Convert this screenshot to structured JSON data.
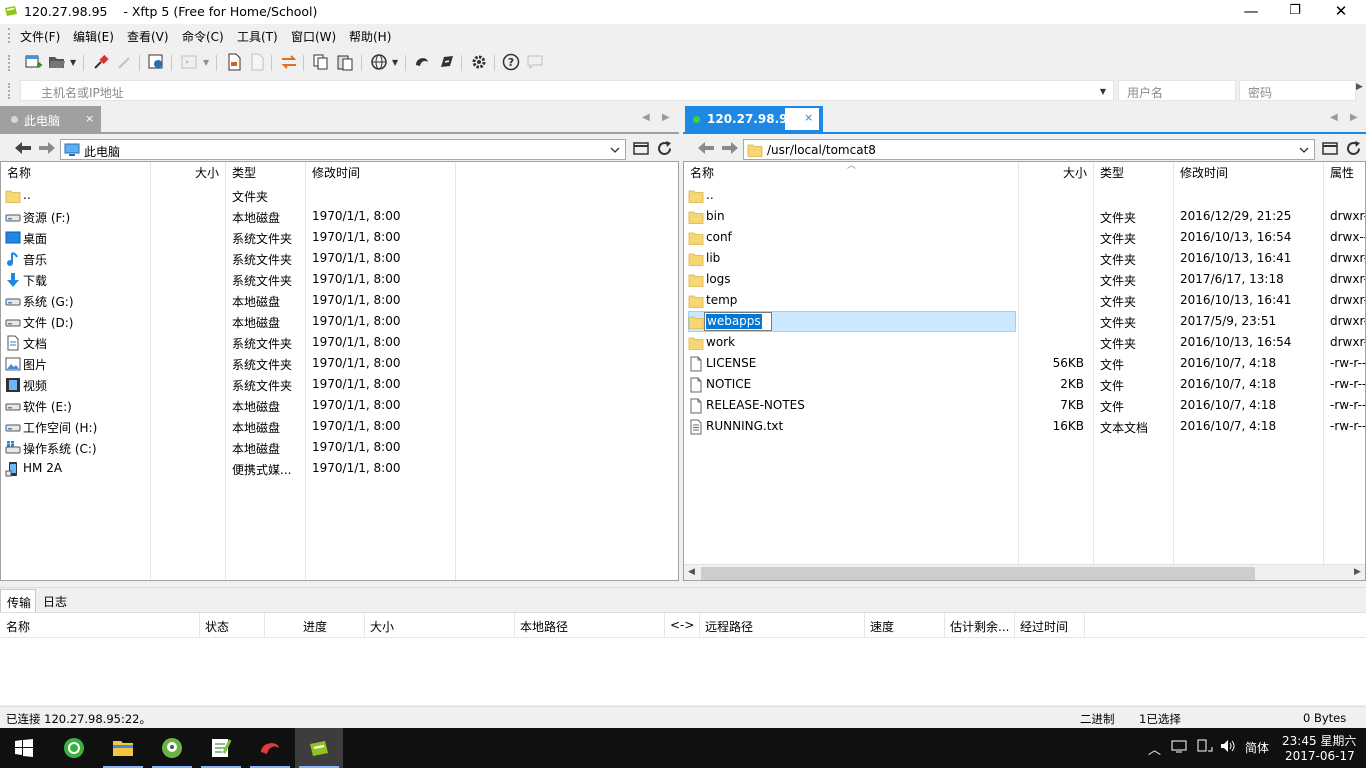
{
  "window": {
    "title": "120.27.98.95    - Xftp 5 (Free for Home/School)",
    "minimize": "—",
    "restore": "❐",
    "close": "✕"
  },
  "menu": [
    "文件(F)",
    "编辑(E)",
    "查看(V)",
    "命令(C)",
    "工具(T)",
    "窗口(W)",
    "帮助(H)"
  ],
  "address": {
    "host_placeholder": "主机名或IP地址",
    "user_placeholder": "用户名",
    "password_placeholder": "密码"
  },
  "local_pane": {
    "tab_label": "此电脑",
    "tab_close": "×",
    "path": "此电脑",
    "columns": [
      "名称",
      "大小",
      "类型",
      "修改时间"
    ],
    "rows": [
      {
        "name": "..",
        "size": "",
        "type": "文件夹",
        "modified": "",
        "icon": "folder-icon"
      },
      {
        "name": "资源 (F:)",
        "size": "",
        "type": "本地磁盘",
        "modified": "1970/1/1, 8:00",
        "icon": "drive-icon"
      },
      {
        "name": "桌面",
        "size": "",
        "type": "系统文件夹",
        "modified": "1970/1/1, 8:00",
        "icon": "desktop-icon"
      },
      {
        "name": "音乐",
        "size": "",
        "type": "系统文件夹",
        "modified": "1970/1/1, 8:00",
        "icon": "music-icon"
      },
      {
        "name": "下载",
        "size": "",
        "type": "系统文件夹",
        "modified": "1970/1/1, 8:00",
        "icon": "download-icon"
      },
      {
        "name": "系统 (G:)",
        "size": "",
        "type": "本地磁盘",
        "modified": "1970/1/1, 8:00",
        "icon": "drive-icon"
      },
      {
        "name": "文件 (D:)",
        "size": "",
        "type": "本地磁盘",
        "modified": "1970/1/1, 8:00",
        "icon": "drive-icon"
      },
      {
        "name": "文档",
        "size": "",
        "type": "系统文件夹",
        "modified": "1970/1/1, 8:00",
        "icon": "document-icon"
      },
      {
        "name": "图片",
        "size": "",
        "type": "系统文件夹",
        "modified": "1970/1/1, 8:00",
        "icon": "pictures-icon"
      },
      {
        "name": "视频",
        "size": "",
        "type": "系统文件夹",
        "modified": "1970/1/1, 8:00",
        "icon": "video-icon"
      },
      {
        "name": "软件 (E:)",
        "size": "",
        "type": "本地磁盘",
        "modified": "1970/1/1, 8:00",
        "icon": "drive-icon"
      },
      {
        "name": "工作空间 (H:)",
        "size": "",
        "type": "本地磁盘",
        "modified": "1970/1/1, 8:00",
        "icon": "drive-icon"
      },
      {
        "name": "操作系统 (C:)",
        "size": "",
        "type": "本地磁盘",
        "modified": "1970/1/1, 8:00",
        "icon": "windows-drive-icon"
      },
      {
        "name": "HM 2A",
        "size": "",
        "type": "便携式媒...",
        "modified": "1970/1/1, 8:00",
        "icon": "phone-icon"
      }
    ]
  },
  "remote_pane": {
    "tab_label": "120.27.98.95",
    "tab_close": "×",
    "path": "/usr/local/tomcat8",
    "columns": [
      "名称",
      "大小",
      "类型",
      "修改时间",
      "属性"
    ],
    "rename_value": "webapps",
    "rows": [
      {
        "name": "..",
        "size": "",
        "type": "",
        "modified": "",
        "attr": "",
        "icon": "folder-icon"
      },
      {
        "name": "bin",
        "size": "",
        "type": "文件夹",
        "modified": "2016/12/29, 21:25",
        "attr": "drwxr-",
        "icon": "folder-icon"
      },
      {
        "name": "conf",
        "size": "",
        "type": "文件夹",
        "modified": "2016/10/13, 16:54",
        "attr": "drwx--",
        "icon": "folder-icon"
      },
      {
        "name": "lib",
        "size": "",
        "type": "文件夹",
        "modified": "2016/10/13, 16:41",
        "attr": "drwxr-",
        "icon": "folder-icon"
      },
      {
        "name": "logs",
        "size": "",
        "type": "文件夹",
        "modified": "2017/6/17, 13:18",
        "attr": "drwxr-",
        "icon": "folder-icon"
      },
      {
        "name": "temp",
        "size": "",
        "type": "文件夹",
        "modified": "2016/10/13, 16:41",
        "attr": "drwxr-",
        "icon": "folder-icon"
      },
      {
        "name": "webapps",
        "size": "",
        "type": "文件夹",
        "modified": "2017/5/9, 23:51",
        "attr": "drwxr-",
        "icon": "folder-icon",
        "selected": true
      },
      {
        "name": "work",
        "size": "",
        "type": "文件夹",
        "modified": "2016/10/13, 16:54",
        "attr": "drwxr-",
        "icon": "folder-icon"
      },
      {
        "name": "LICENSE",
        "size": "56KB",
        "type": "文件",
        "modified": "2016/10/7, 4:18",
        "attr": "-rw-r--",
        "icon": "file-icon"
      },
      {
        "name": "NOTICE",
        "size": "2KB",
        "type": "文件",
        "modified": "2016/10/7, 4:18",
        "attr": "-rw-r--",
        "icon": "file-icon"
      },
      {
        "name": "RELEASE-NOTES",
        "size": "7KB",
        "type": "文件",
        "modified": "2016/10/7, 4:18",
        "attr": "-rw-r--",
        "icon": "file-icon"
      },
      {
        "name": "RUNNING.txt",
        "size": "16KB",
        "type": "文本文档",
        "modified": "2016/10/7, 4:18",
        "attr": "-rw-r--",
        "icon": "text-file-icon"
      }
    ]
  },
  "transfer": {
    "tabs": [
      "传输",
      "日志"
    ],
    "columns": [
      "名称",
      "状态",
      "进度",
      "大小",
      "本地路径",
      "<->",
      "远程路径",
      "速度",
      "估计剩余...",
      "经过时间"
    ]
  },
  "status": {
    "connection": "已连接 120.27.98.95:22。",
    "mode": "二进制",
    "selected": "1已选择",
    "bytes": "0 Bytes"
  },
  "taskbar": {
    "ime": "简体",
    "time": "23:45 星期六",
    "date": "2017-06-17"
  },
  "colors": {
    "accent": "#1e88e5",
    "selection": "#cce8ff",
    "folder": "#f7d774",
    "connected": "#3bd23b"
  }
}
